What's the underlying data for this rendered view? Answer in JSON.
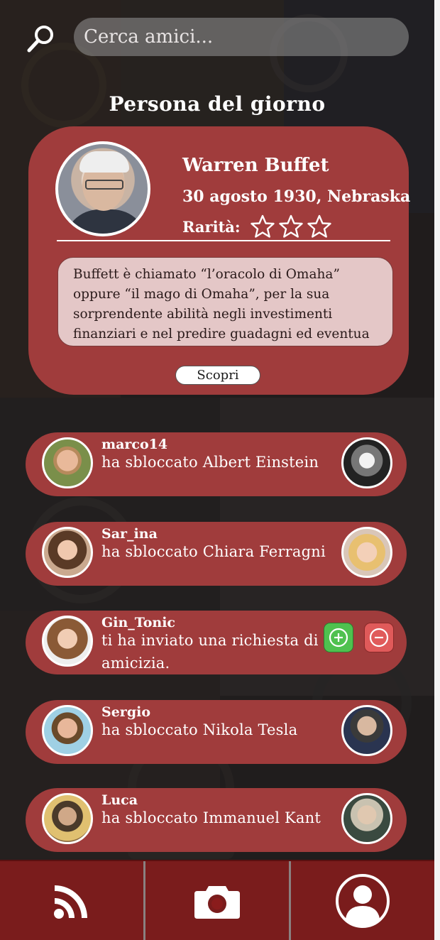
{
  "search": {
    "placeholder": "Cerca amici..."
  },
  "featured": {
    "section_title": "Persona del giorno",
    "name": "Warren Buffet",
    "info": "30 agosto 1930, Nebraska",
    "rarity_label": "Rarità:",
    "rarity_stars": 3,
    "bio_lines": [
      "Buffett è chiamato “l’oracolo di Omaha”",
      "oppure “il mago di Omaha”, per la sua",
      "sorprendente abilità negli investimenti",
      "finanziari e nel predire guadagni ed eventua"
    ],
    "discover_label": "Scopri"
  },
  "activities": [
    {
      "user": "marco14",
      "message": "ha sbloccato Albert Einstein"
    },
    {
      "user": "Sar_ina",
      "message": "ha sbloccato Chiara Ferragni"
    },
    {
      "user": "Gin_Tonic",
      "message": "ti ha inviato una richiesta di amicizia."
    },
    {
      "user": "Sergio",
      "message": "ha sbloccato Nikola Tesla"
    },
    {
      "user": "Luca",
      "message": "ha sbloccato Immanuel Kant"
    }
  ],
  "nav": {
    "tabs": [
      {
        "icon": "feed-icon"
      },
      {
        "icon": "camera-icon"
      },
      {
        "icon": "profile-icon"
      }
    ]
  },
  "colors": {
    "card": "#a03c3c",
    "nav": "#7a1c1c",
    "accept": "#4fc14f",
    "decline": "#e05a5a"
  }
}
